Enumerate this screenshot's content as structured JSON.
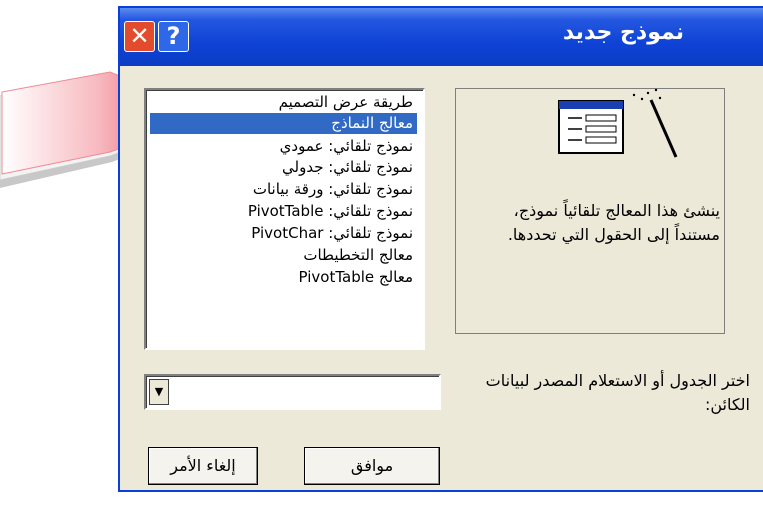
{
  "window": {
    "title": "نموذج جديد",
    "help_glyph": "?",
    "close_glyph": "✕"
  },
  "preview": {
    "description": "ينشئ هذا المعالج تلقائياً نموذج، مستنداً إلى الحقول التي تحددها."
  },
  "list": {
    "items": [
      "طريقة عرض التصميم",
      "معالج النماذج",
      "نموذج تلقائي: عمودي",
      "نموذج تلقائي: جدولي",
      "نموذج تلقائي: ورقة بيانات",
      "نموذج تلقائي: PivotTable",
      "نموذج تلقائي: PivotChar",
      "معالج التخطيطات",
      "معالج PivotTable"
    ],
    "selected_index": 1
  },
  "source": {
    "label": "اختر الجدول أو الاستعلام المصدر لبيانات الكائن:",
    "value": ""
  },
  "buttons": {
    "ok": "موافق",
    "cancel": "إلغاء الأمر"
  },
  "colors": {
    "titlebar": "#0a3cc4",
    "selection": "#316ac5",
    "dialog_bg": "#ece9d8",
    "close": "#e24b2b",
    "arrow_tip": "#e8293b"
  },
  "icons": {
    "callout": "arrow-pointer-icon",
    "wizard": "form-wizard-icon",
    "dropdown": "down-triangle-icon"
  }
}
